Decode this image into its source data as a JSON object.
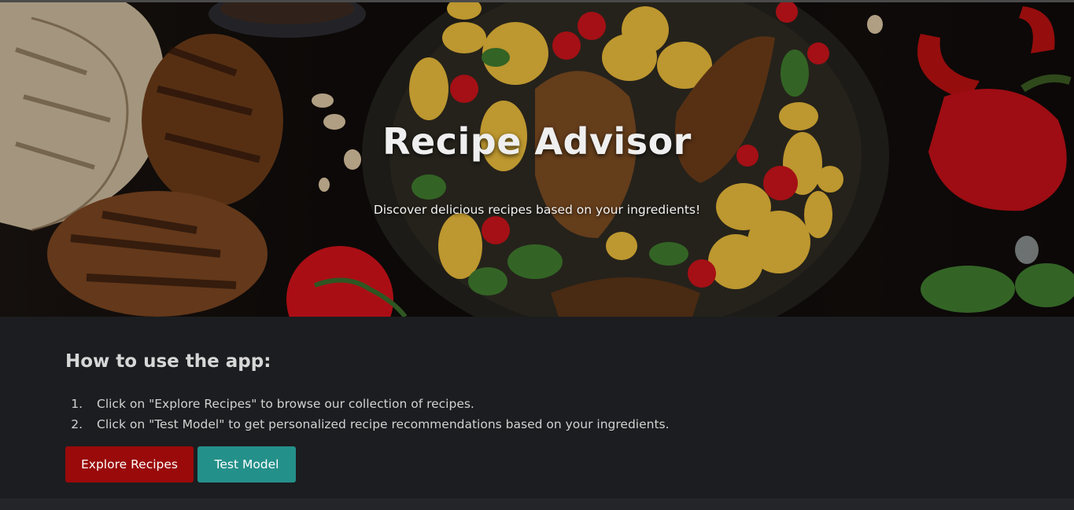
{
  "hero": {
    "title": "Recipe Advisor",
    "subtitle": "Discover delicious recipes based on your ingredients!"
  },
  "instructions": {
    "heading": "How to use the app:",
    "steps": [
      {
        "number": "1.",
        "text": "Click on \"Explore Recipes\" to browse our collection of recipes."
      },
      {
        "number": "2.",
        "text": "Click on \"Test Model\" to get personalized recipe recommendations based on your ingredients."
      }
    ]
  },
  "buttons": {
    "explore_label": "Explore Recipes",
    "test_label": "Test Model"
  },
  "colors": {
    "explore_button": "#9a0a0a",
    "test_button": "#24908a",
    "background": "#1c1d20"
  }
}
